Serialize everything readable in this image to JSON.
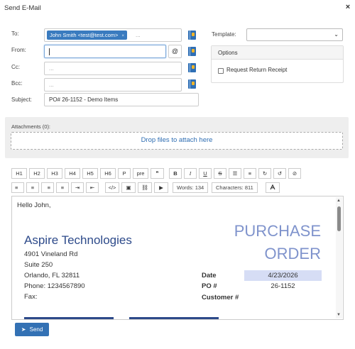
{
  "dialog": {
    "title": "Send E-Mail",
    "close": "×"
  },
  "fields": {
    "to_label": "To:",
    "to_chip": "John Smith <test@test.com>",
    "to_chip_remove": "×",
    "to_placeholder": "...",
    "from_label": "From:",
    "from_value": "",
    "at_symbol": "@",
    "cc_label": "Cc:",
    "cc_placeholder": "...",
    "bcc_label": "Bcc:",
    "bcc_placeholder": "...",
    "subject_label": "Subject:",
    "subject_value": "PO# 26-1152 - Demo Items"
  },
  "template": {
    "label": "Template:",
    "selected": ""
  },
  "options": {
    "heading": "Options",
    "request_receipt": "Request Return Receipt",
    "request_receipt_checked": false
  },
  "attachments": {
    "label": "Attachments (0):",
    "drop_text": "Drop files to attach here"
  },
  "toolbar": {
    "row1": [
      "H1",
      "H2",
      "H3",
      "H4",
      "H5",
      "H6",
      "P",
      "pre",
      "❞",
      "B",
      "I",
      "U",
      "S",
      "☰",
      "≡",
      "↻",
      "↺",
      "⊘"
    ],
    "row2": [
      "≡",
      "≡",
      "≡",
      "≡",
      "⇥",
      "⇤",
      "</>",
      "▣",
      "⛓",
      "▶"
    ],
    "words": "Words: 134",
    "characters": "Characters: 811"
  },
  "editor": {
    "greeting": "Hello John,",
    "company": "Aspire Technologies",
    "address1": "4901 Vineland Rd",
    "address2": "Suite 250",
    "city": "Orlando, FL 32811",
    "phone": "Phone: 1234567890",
    "fax": "Fax:",
    "doc_title_1": "PURCHASE",
    "doc_title_2": "ORDER",
    "date_label": "Date",
    "date_value": "4/23/2026",
    "po_label": "PO #",
    "po_value": "26-1152",
    "customer_label": "Customer #",
    "customer_value": ""
  },
  "footer": {
    "send": "Send"
  },
  "colors": {
    "accent": "#3371b4",
    "chip": "#3a7bbf",
    "doc_title": "#7f93cc",
    "company": "#2d4a8a",
    "date_highlight": "#d6ddf5"
  }
}
